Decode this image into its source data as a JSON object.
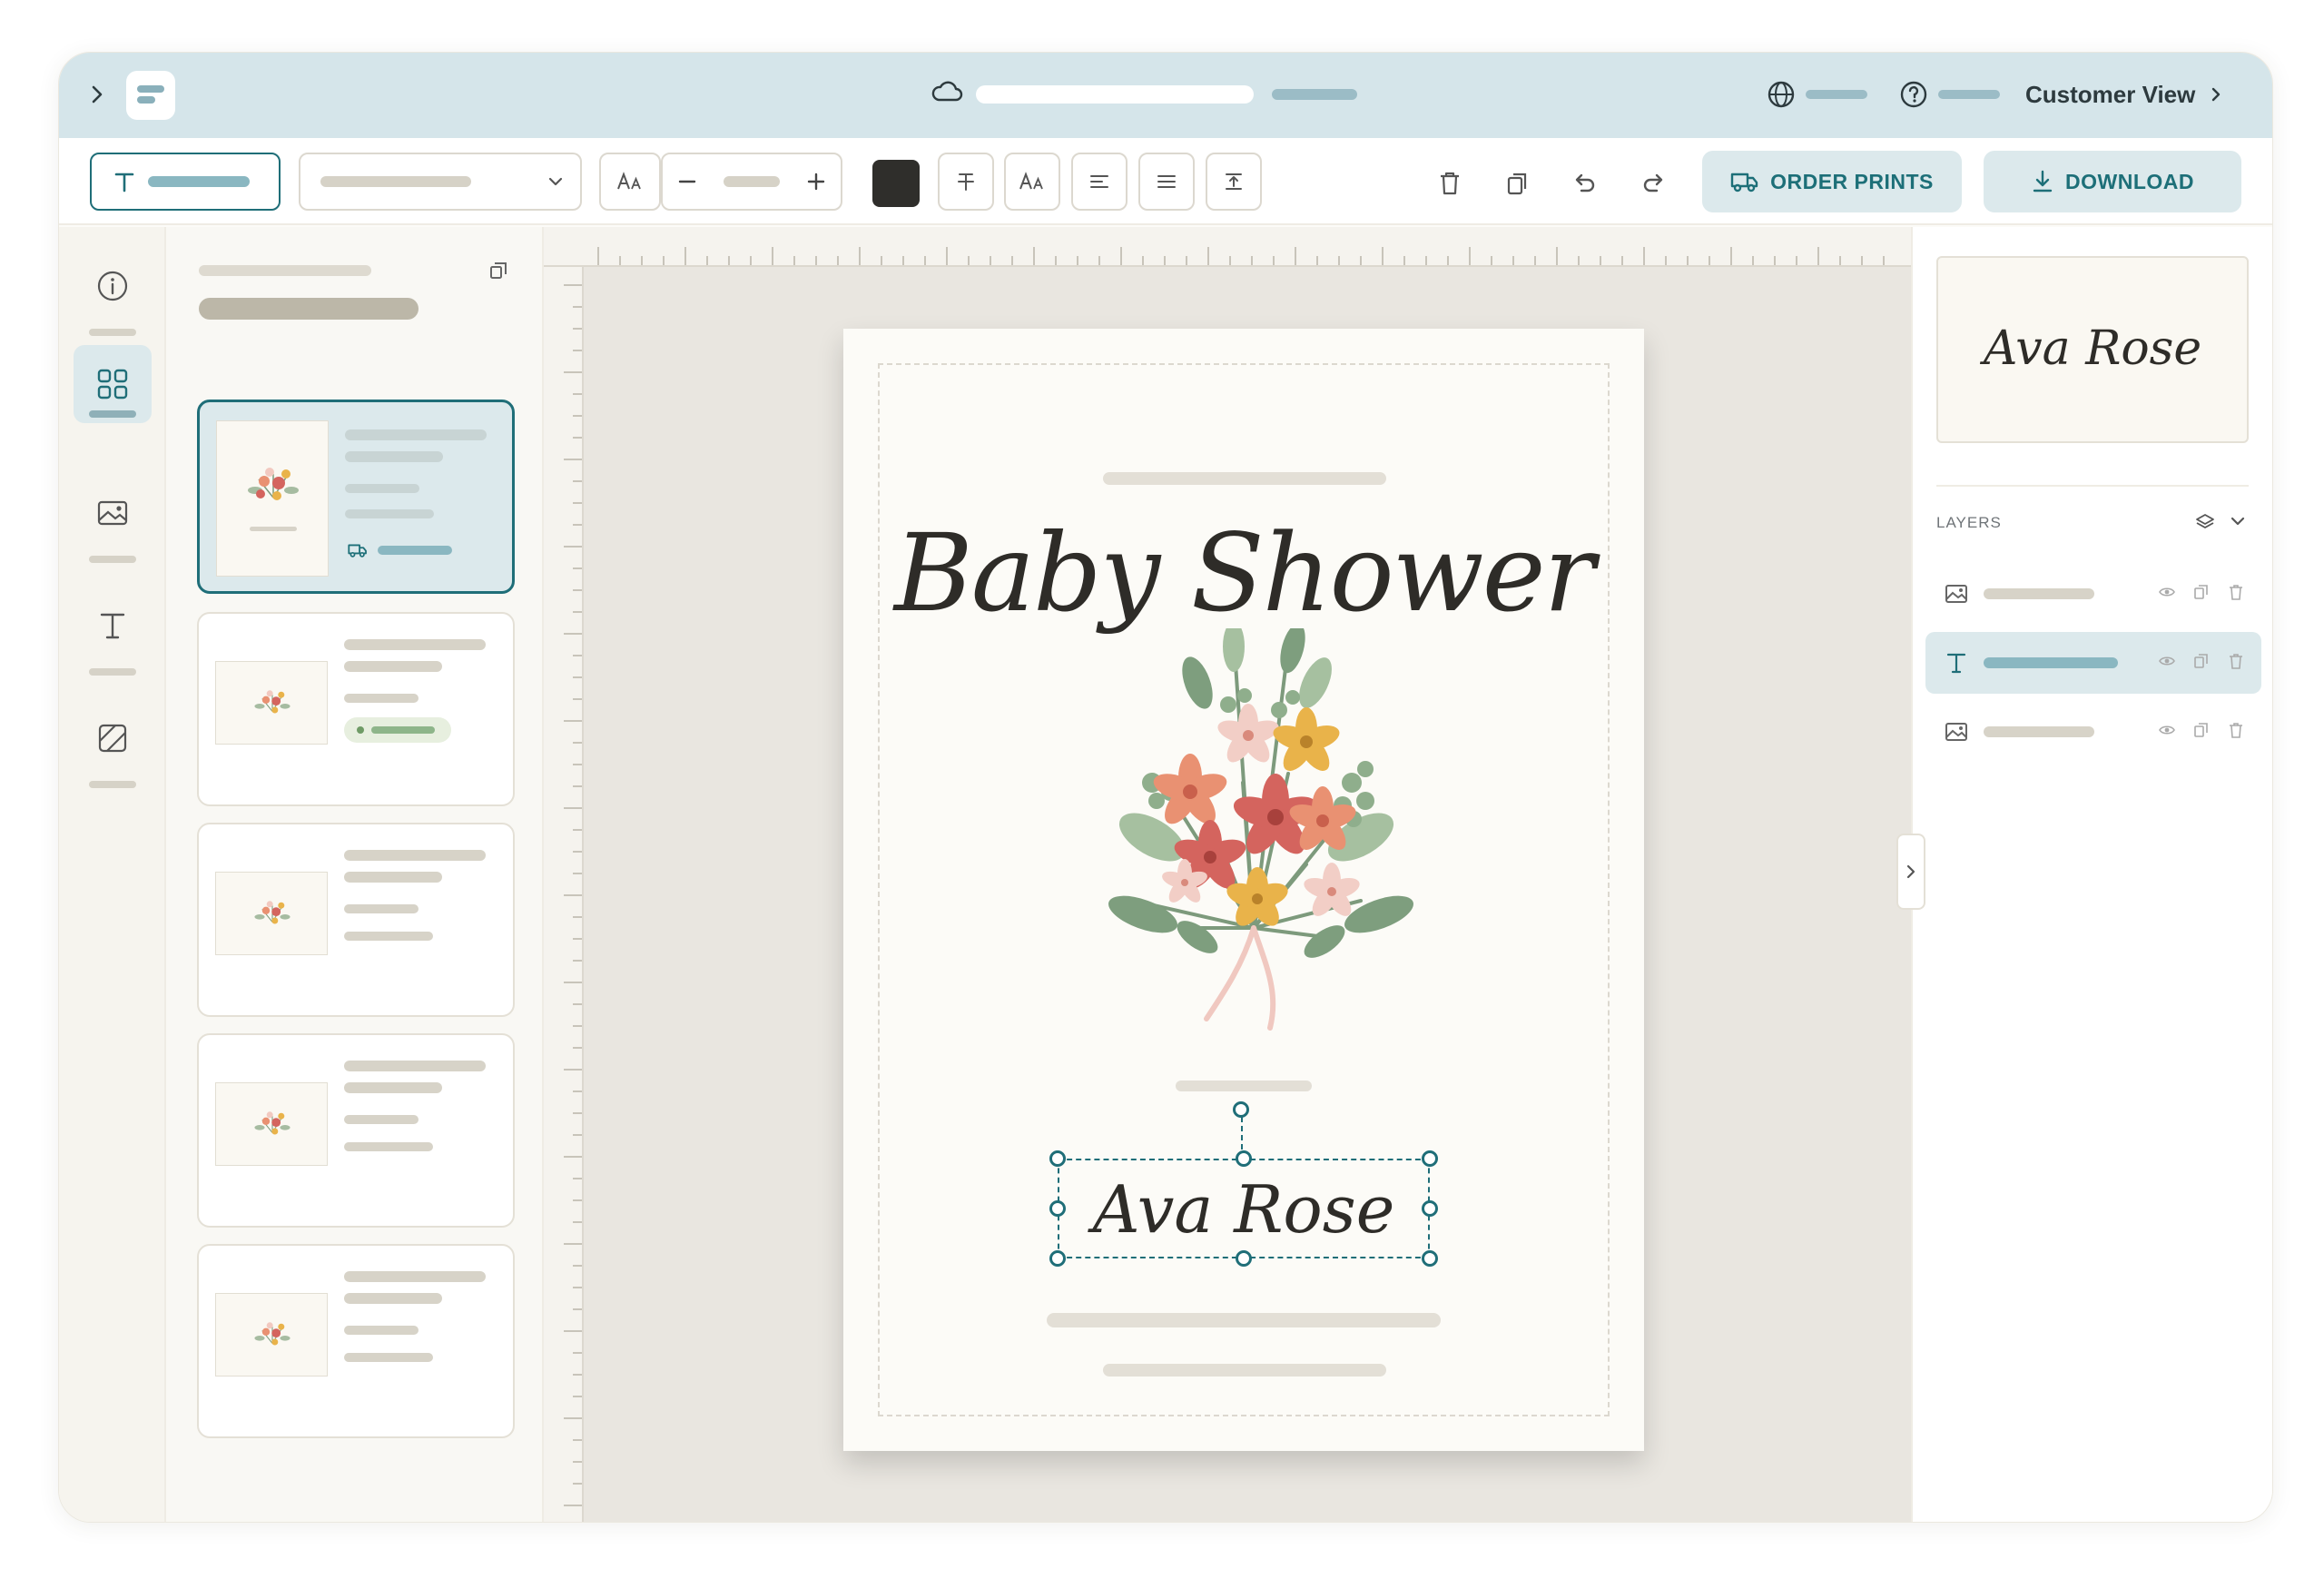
{
  "topbar": {
    "customer_view_label": "Customer View"
  },
  "toolbar": {
    "order_prints_label": "ORDER PRINTS",
    "download_label": "DOWNLOAD",
    "text_color": "#2f2e2b"
  },
  "rail": {
    "items": [
      {
        "icon": "info-icon",
        "active": false
      },
      {
        "icon": "templates-grid-icon",
        "active": true
      },
      {
        "icon": "image-icon",
        "active": false
      },
      {
        "icon": "text-icon",
        "active": false
      },
      {
        "icon": "background-icon",
        "active": false
      }
    ]
  },
  "canvas": {
    "headline": "Baby Shower",
    "name_text": "Ava Rose"
  },
  "right_panel": {
    "preview_text": "Ava Rose",
    "layers_title": "LAYERS",
    "layers": [
      {
        "type": "image-icon",
        "active": false
      },
      {
        "type": "text-icon",
        "active": true
      },
      {
        "type": "image-icon",
        "active": false
      }
    ]
  },
  "colors": {
    "accent": "#1f6e78",
    "accent_light": "#dce9ec",
    "topbar": "#d5e5ea",
    "canvas_bg": "#e9e6e0",
    "page_bg": "#fcfbf7"
  }
}
